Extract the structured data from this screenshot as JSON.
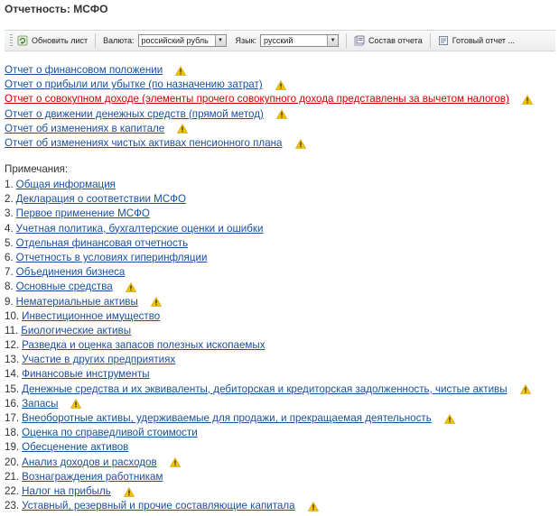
{
  "page": {
    "title": "Отчетность: МСФО"
  },
  "toolbar": {
    "refresh_label": "Обновить лист",
    "currency_label": "Валюта:",
    "currency_value": "российский рубль",
    "language_label": "Язык:",
    "language_value": "русский",
    "report_composition_label": "Состав отчета",
    "ready_report_label": "Готовый отчет ..."
  },
  "reports": [
    {
      "label": "Отчет о финансовом положении",
      "warning": true,
      "highlight": false
    },
    {
      "label": "Отчет о прибыли или убытке (по назначению затрат)",
      "warning": true,
      "highlight": false
    },
    {
      "label": "Отчет о совокупном доходе (элементы прочего совокупного дохода представлены за вычетом налогов)",
      "warning": true,
      "highlight": true
    },
    {
      "label": "Отчет о движении денежных средств (прямой метод)",
      "warning": true,
      "highlight": false
    },
    {
      "label": "Отчет об изменениях в капитале",
      "warning": true,
      "highlight": false
    },
    {
      "label": "Отчет об изменениях чистых активах пенсионного плана",
      "warning": true,
      "highlight": false
    }
  ],
  "notes_heading": "Примечания:",
  "notes": [
    {
      "num": "1.",
      "label": "Общая информация",
      "warning": false
    },
    {
      "num": "2.",
      "label": "Декларация о соответствии МСФО",
      "warning": false
    },
    {
      "num": "3.",
      "label": "Первое применение МСФО",
      "warning": false
    },
    {
      "num": "4.",
      "label": "Учетная политика, бухгалтерские оценки и ошибки",
      "warning": false
    },
    {
      "num": "5.",
      "label": "Отдельная финансовая отчетность",
      "warning": false
    },
    {
      "num": "6.",
      "label": "Отчетность в условиях гиперинфляции",
      "warning": false
    },
    {
      "num": "7.",
      "label": "Объединения бизнеса",
      "warning": false
    },
    {
      "num": "8.",
      "label": "Основные средства",
      "warning": true
    },
    {
      "num": "9.",
      "label": "Нематериальные активы",
      "warning": true
    },
    {
      "num": "10.",
      "label": "Инвестиционное имущество",
      "warning": false
    },
    {
      "num": "11.",
      "label": "Биологические активы",
      "warning": false
    },
    {
      "num": "12.",
      "label": "Разведка и оценка запасов полезных ископаемых",
      "warning": false
    },
    {
      "num": "13.",
      "label": "Участие в других предприятиях",
      "warning": false
    },
    {
      "num": "14.",
      "label": "Финансовые инструменты",
      "warning": false
    },
    {
      "num": "15.",
      "label": "Денежные средства и их эквиваленты, дебиторская и кредиторская задолженность, чистые активы",
      "warning": true
    },
    {
      "num": "16.",
      "label": "Запасы",
      "warning": true
    },
    {
      "num": "17.",
      "label": "Внеоборотные активы, удерживаемые для продажи, и прекращаемая деятельность",
      "warning": true
    },
    {
      "num": "18.",
      "label": "Оценка по справедливой стоимости",
      "warning": false
    },
    {
      "num": "19.",
      "label": "Обесценение активов",
      "warning": false
    },
    {
      "num": "20.",
      "label": "Анализ доходов и расходов",
      "warning": true
    },
    {
      "num": "21.",
      "label": "Вознаграждения работникам",
      "warning": false
    },
    {
      "num": "22.",
      "label": "Налог на прибыль",
      "warning": true
    },
    {
      "num": "23.",
      "label": "Уставный, резервный и прочие составляющие капитала",
      "warning": true
    }
  ],
  "colors": {
    "link": "#1a4f9c",
    "highlight_link": "#cc0000",
    "warning": "#f5c400"
  },
  "icons": {
    "warning": "warning-triangle-icon",
    "refresh": "refresh-icon",
    "composition": "report-composition-icon",
    "ready": "ready-report-icon"
  }
}
